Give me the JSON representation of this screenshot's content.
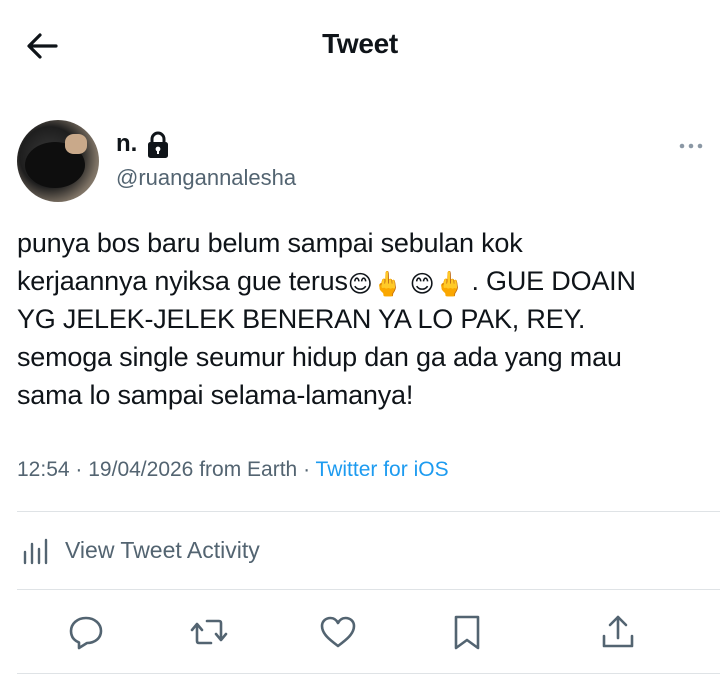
{
  "header": {
    "title": "Tweet",
    "back_icon": "arrow-left-icon"
  },
  "author": {
    "display_name": "n.",
    "handle": "@ruangannalesha",
    "protected_icon": "lock-icon"
  },
  "tweet": {
    "line1": "punya bos baru belum sampai sebulan kok",
    "line2_text": "kerjaannya nyiksa gue terus",
    "emoji_smile": "😊",
    "emoji_finger": "🖕",
    "line2_tail": ". GUE DOAIN",
    "line3": "YG JELEK-JELEK BENERAN YA LO PAK, REY.",
    "line4": "semoga single seumur hidup dan ga ada yang mau",
    "line5": "sama lo sampai selama-lamanya!"
  },
  "meta": {
    "time": "12:54",
    "date": "19/04/2026",
    "location": "from Earth",
    "separator": "·",
    "source": "Twitter for iOS"
  },
  "activity": {
    "label": "View Tweet Activity",
    "icon": "bar-chart-icon"
  },
  "actions": [
    "reply-icon",
    "retweet-icon",
    "like-icon",
    "bookmark-icon",
    "share-icon"
  ],
  "colors": {
    "text": "#0f1419",
    "secondary": "#536471",
    "link": "#1d9bf0",
    "divider": "#dfe3e6"
  }
}
